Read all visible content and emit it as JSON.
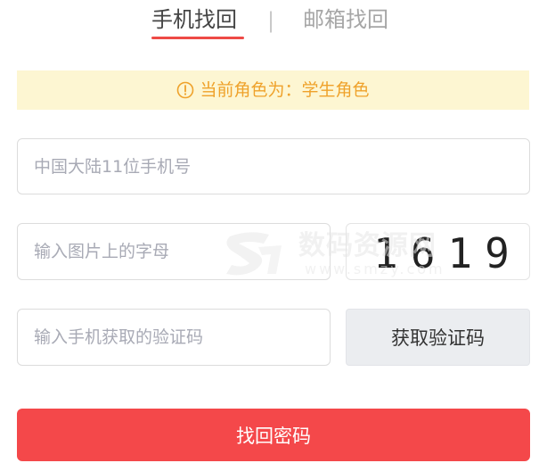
{
  "tabs": {
    "phone_label": "手机找回",
    "separator": "|",
    "email_label": "邮箱找回"
  },
  "notice": {
    "text": "当前角色为：学生角色",
    "icon": "exclamation-circle-icon",
    "color": "#efa22b",
    "background": "#fdf6d2"
  },
  "form": {
    "phone_placeholder": "中国大陆11位手机号",
    "captcha_placeholder": "输入图片上的字母",
    "sms_placeholder": "输入手机获取的验证码",
    "captcha_image_text": "1619",
    "sms_button_label": "获取验证码",
    "submit_label": "找回密码"
  },
  "watermark": {
    "main": "数码资源网",
    "sub": "www.smzy.com"
  },
  "colors": {
    "accent": "#f4484a",
    "tab_underline": "#ee4a46"
  }
}
